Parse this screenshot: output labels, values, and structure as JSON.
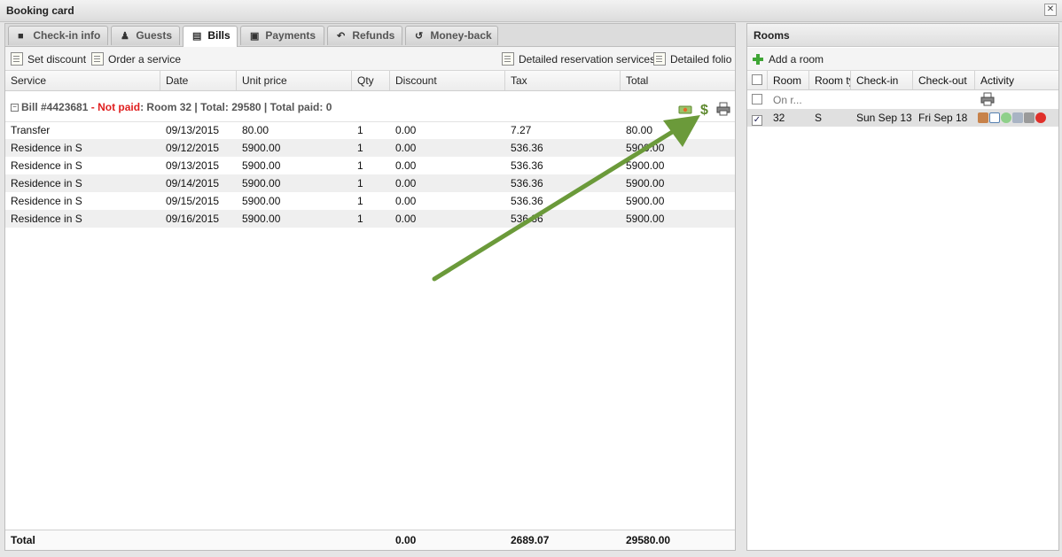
{
  "window": {
    "title": "Booking card"
  },
  "tabs": [
    {
      "label": "Check-in info",
      "icon": "briefcase-icon"
    },
    {
      "label": "Guests",
      "icon": "users-icon"
    },
    {
      "label": "Bills",
      "icon": "document-icon",
      "active": true
    },
    {
      "label": "Payments",
      "icon": "cash-icon"
    },
    {
      "label": "Refunds",
      "icon": "undo-icon"
    },
    {
      "label": "Money-back",
      "icon": "rotate-icon"
    }
  ],
  "toolbar": {
    "set_discount": "Set discount",
    "order_service": "Order a service",
    "detailed_reservation": "Detailed reservation services",
    "detailed_folio": "Detailed folio"
  },
  "columns": [
    "Service",
    "Date",
    "Unit price",
    "Qty",
    "Discount",
    "Tax",
    "Total"
  ],
  "bill": {
    "prefix": "Bill #4423681",
    "dash": " - ",
    "status": "Not paid",
    "details": ": Room 32 | Total: 29580 | Total paid: 0"
  },
  "rows": [
    [
      "Transfer",
      "09/13/2015",
      "80.00",
      "1",
      "0.00",
      "7.27",
      "80.00"
    ],
    [
      "Residence in S",
      "09/12/2015",
      "5900.00",
      "1",
      "0.00",
      "536.36",
      "5900.00"
    ],
    [
      "Residence in S",
      "09/13/2015",
      "5900.00",
      "1",
      "0.00",
      "536.36",
      "5900.00"
    ],
    [
      "Residence in S",
      "09/14/2015",
      "5900.00",
      "1",
      "0.00",
      "536.36",
      "5900.00"
    ],
    [
      "Residence in S",
      "09/15/2015",
      "5900.00",
      "1",
      "0.00",
      "536.36",
      "5900.00"
    ],
    [
      "Residence in S",
      "09/16/2015",
      "5900.00",
      "1",
      "0.00",
      "536.36",
      "5900.00"
    ]
  ],
  "footer": {
    "label": "Total",
    "discount": "0.00",
    "tax": "2689.07",
    "total": "29580.00"
  },
  "rooms": {
    "title": "Rooms",
    "add_label": "Add a room",
    "columns": [
      "Room",
      "Room ty",
      "Check-in",
      "Check-out",
      "Activity"
    ],
    "rows": [
      {
        "room": "On r...",
        "type": "",
        "checkin": "",
        "checkout": "",
        "checked": false
      },
      {
        "room": "32",
        "type": "S",
        "checkin": "Sun Sep 13",
        "checkout": "Fri Sep 18",
        "checked": true
      }
    ]
  },
  "colors": {
    "not_paid": "#e02020",
    "arrow": "#6b9a3a",
    "accent_green": "#3fa535"
  }
}
